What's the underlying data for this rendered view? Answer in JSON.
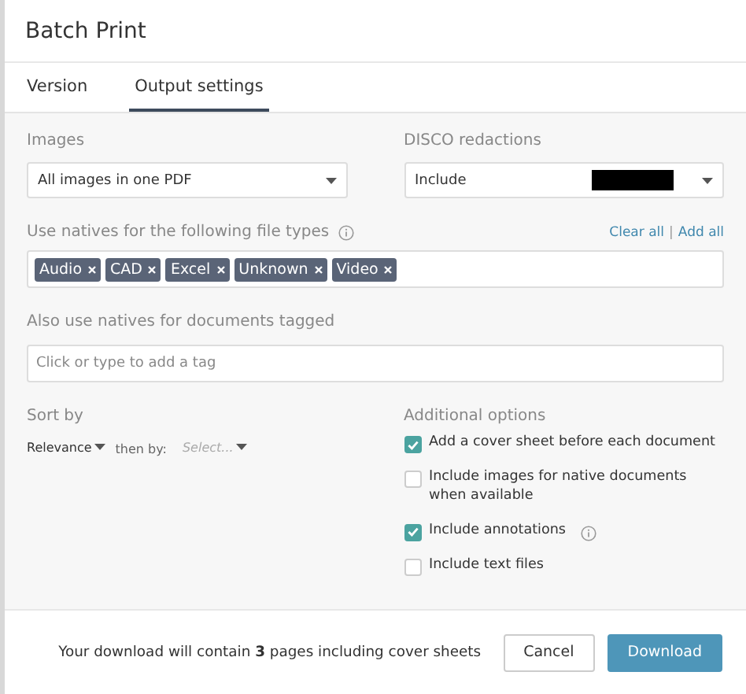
{
  "window": {
    "title": "Batch Print"
  },
  "tabs": [
    {
      "label": "Version",
      "selected": false
    },
    {
      "label": "Output settings",
      "selected": true
    }
  ],
  "images": {
    "label": "Images",
    "value": "All images in one PDF"
  },
  "redactions": {
    "label": "DISCO redactions",
    "value": "Include",
    "redacted": true
  },
  "natives": {
    "label": "Use natives for the following file types",
    "links": [
      "Clear all",
      "Add all"
    ],
    "link_separator": "|",
    "tags": [
      "Audio",
      "CAD",
      "Excel",
      "Unknown",
      "Video"
    ]
  },
  "tagged": {
    "label": "Also use natives for documents tagged",
    "placeholder": "Click or type to add a tag"
  },
  "sort": {
    "label": "Sort by",
    "primary": "Relevance",
    "then_label": "then by:",
    "secondary_placeholder": "Select..."
  },
  "options": {
    "label": "Additional options",
    "items": [
      {
        "label": "Add a cover sheet before each document",
        "checked": true,
        "info": false
      },
      {
        "label": "Include images for native documents when available",
        "checked": false,
        "info": false
      },
      {
        "label": "Include annotations",
        "checked": true,
        "info": true
      },
      {
        "label": "Include text files",
        "checked": false,
        "info": false
      }
    ]
  },
  "footer": {
    "summary": "Your download will contain **3** pages including cover sheets",
    "buttons": [
      {
        "label": "Cancel",
        "kind": "secondary"
      },
      {
        "label": "Download",
        "kind": "primary"
      }
    ]
  }
}
